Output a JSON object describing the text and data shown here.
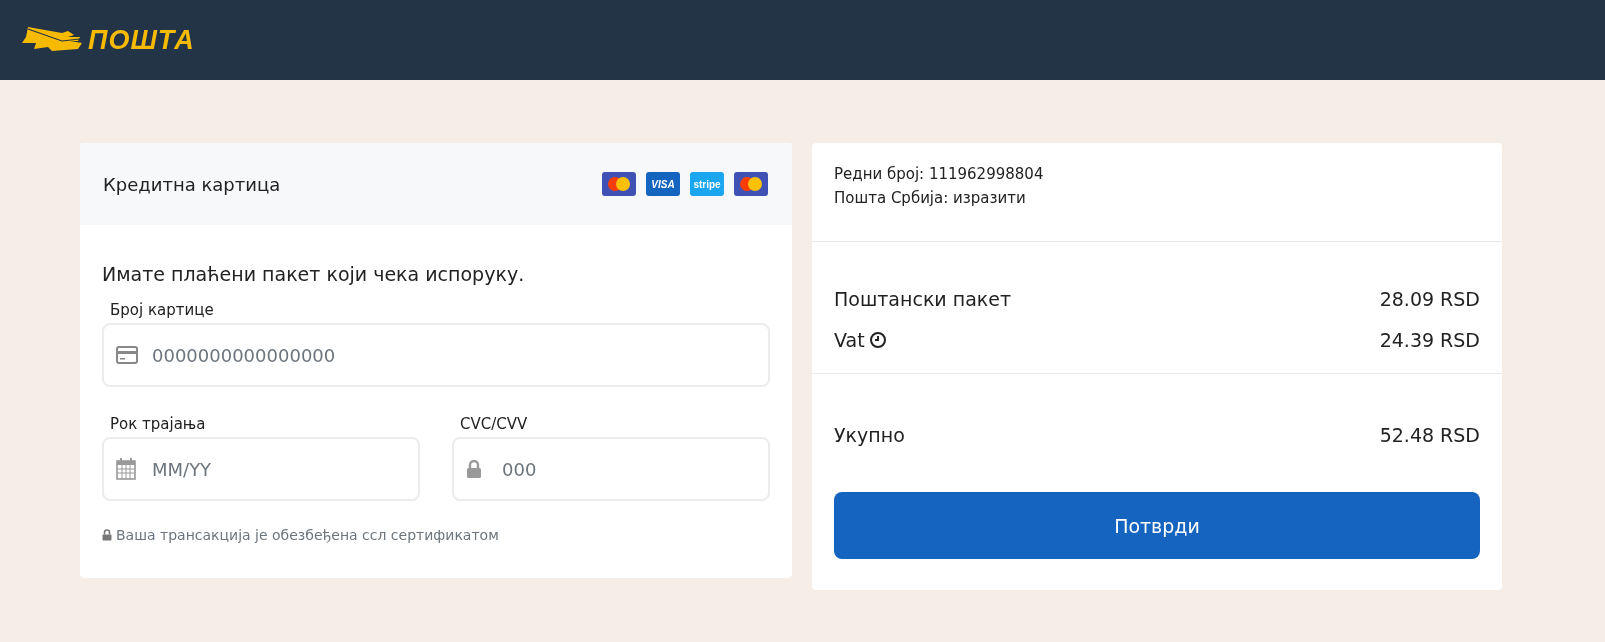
{
  "header": {
    "logo_text": "ПОШТА"
  },
  "payment_card": {
    "title": "Кредитна картица",
    "brands": [
      {
        "kind": "mastercard"
      },
      {
        "kind": "visa",
        "text": "VISA"
      },
      {
        "kind": "stripe",
        "text": "stripe"
      },
      {
        "kind": "mastercard"
      }
    ],
    "message": "Имате плаћени пакет који чека испоруку.",
    "fields": [
      {
        "kind": "card",
        "label": "Број картице",
        "placeholder": "0000000000000000"
      },
      {
        "kind": "date",
        "label": "Рок трајања",
        "placeholder": "MM/YY"
      },
      {
        "kind": "lock",
        "label": "CVC/CVV",
        "placeholder": "000"
      }
    ],
    "security_note": "Ваша трансакција је обезбеђена ссл сертификатом"
  },
  "summary": {
    "info": [
      "Редни број: 111962998804",
      "Пошта Србија: изразити"
    ],
    "lines": [
      {
        "label": "Поштански пакет",
        "amount": "28.09 RSD",
        "info_icon": false
      },
      {
        "label": "Vat",
        "amount": "24.39 RSD",
        "info_icon": true
      }
    ],
    "total": {
      "label": "Укупно",
      "amount": "52.48 RSD"
    },
    "button": "Потврди"
  }
}
